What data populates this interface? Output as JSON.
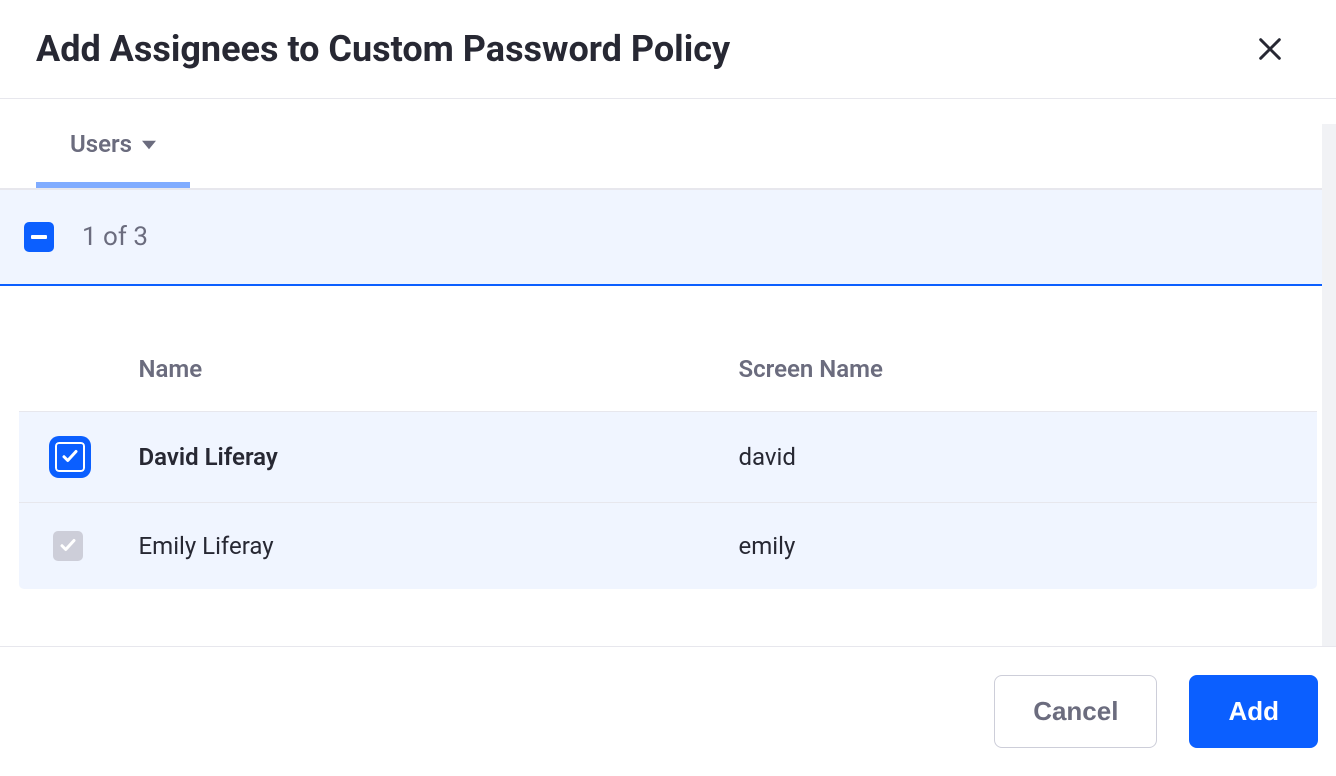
{
  "header": {
    "title": "Add Assignees to Custom Password Policy"
  },
  "tabs": {
    "active": {
      "label": "Users"
    }
  },
  "selection": {
    "count_text": "1 of 3"
  },
  "table": {
    "columns": {
      "name": "Name",
      "screen_name": "Screen Name"
    },
    "rows": [
      {
        "name": "David Liferay",
        "screen_name": "david",
        "checked": true,
        "disabled": false
      },
      {
        "name": "Emily Liferay",
        "screen_name": "emily",
        "checked": true,
        "disabled": true
      }
    ]
  },
  "footer": {
    "cancel_label": "Cancel",
    "add_label": "Add"
  }
}
